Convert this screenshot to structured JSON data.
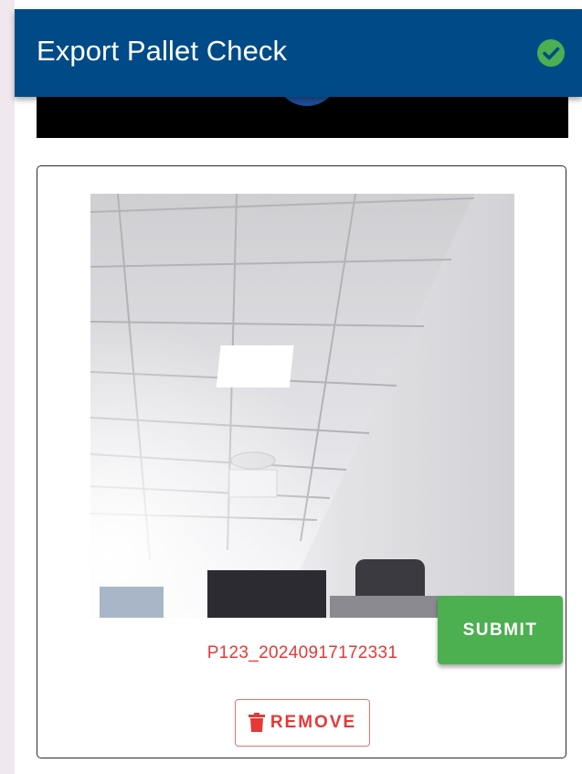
{
  "header": {
    "title": "Export Pallet Check",
    "status_icon": "check-circle-icon",
    "status_color": "#4caf50",
    "background": "#004b87"
  },
  "capture": {
    "filename": "P123_20240917172331",
    "remove_label": "REMOVE",
    "remove_icon": "trash-icon"
  },
  "actions": {
    "submit_label": "SUBMIT",
    "submit_color": "#4caf50"
  },
  "colors": {
    "danger": "#e53935"
  }
}
